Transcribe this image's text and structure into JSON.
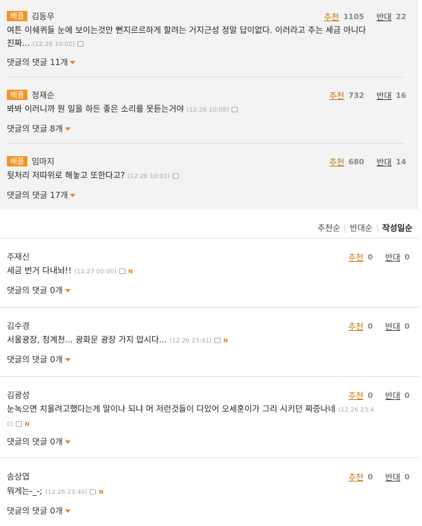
{
  "best_comments": [
    {
      "badge": "베플",
      "author": "김동우",
      "recommend_label": "추천",
      "recommend_count": "1105",
      "oppose_label": "반대",
      "oppose_count": "22",
      "text_line1": "여튼 이쉐퀴들 눈에 보이는것만 뻔지르르하게 할려는 거지근성 정말 답이없다. 이러라고 주는 세금 아니다",
      "text_line2": "진짜...",
      "timestamp": "(12.26 10:02)",
      "replies": "댓글의 댓글 11개"
    },
    {
      "badge": "베플",
      "author": "정재순",
      "recommend_label": "추천",
      "recommend_count": "732",
      "oppose_label": "반대",
      "oppose_count": "16",
      "text_line1": "봐봐 이러니까 뭔 일을 하든 좋은 소리를 못듣는거야",
      "timestamp": "(12.26 10:08)",
      "replies": "댓글의 댓글 8개"
    },
    {
      "badge": "베플",
      "author": "임마지",
      "recommend_label": "추천",
      "recommend_count": "680",
      "oppose_label": "반대",
      "oppose_count": "14",
      "text_line1": "뒷처리 저따위로 해놓고 또한다고?",
      "timestamp": "(12.26 10:01)",
      "replies": "댓글의 댓글 17개"
    }
  ],
  "sort": {
    "recommend": "추천순",
    "oppose": "반대순",
    "date": "작성일순"
  },
  "comments": [
    {
      "author": "주재신",
      "recommend_label": "추천",
      "recommend_count": "0",
      "oppose_label": "반대",
      "oppose_count": "0",
      "text_line1": "세금 번거 다내놔!!",
      "timestamp": "(12.27 00:00)",
      "new_badge": "N",
      "replies": "댓글의 댓글 0개"
    },
    {
      "author": "김수경",
      "recommend_label": "추천",
      "recommend_count": "0",
      "oppose_label": "반대",
      "oppose_count": "0",
      "text_line1": "서울광장, 청계천... 광화문 광장 가지 맙시다...",
      "timestamp": "(12.26 23:41)",
      "new_badge": "N",
      "replies": "댓글의 댓글 0개"
    },
    {
      "author": "김광성",
      "recommend_label": "추천",
      "recommend_count": "0",
      "oppose_label": "반대",
      "oppose_count": "0",
      "text_line1": "눈녹으면 치울려고했다는게 말이나 되냐 머 저런것들이 다있어 오세훈이가 그리 시키던 짜증나네",
      "timestamp_part1": "(12.26 23:4",
      "timestamp_part2": "0)",
      "new_badge": "N",
      "replies": "댓글의 댓글 0개"
    },
    {
      "author": "송상엽",
      "recommend_label": "추천",
      "recommend_count": "0",
      "oppose_label": "반대",
      "oppose_count": "0",
      "text_line1": "뭐게는-_-;",
      "timestamp": "(12.26 23:40)",
      "new_badge": "N",
      "replies": "댓글의 댓글 0개"
    }
  ]
}
